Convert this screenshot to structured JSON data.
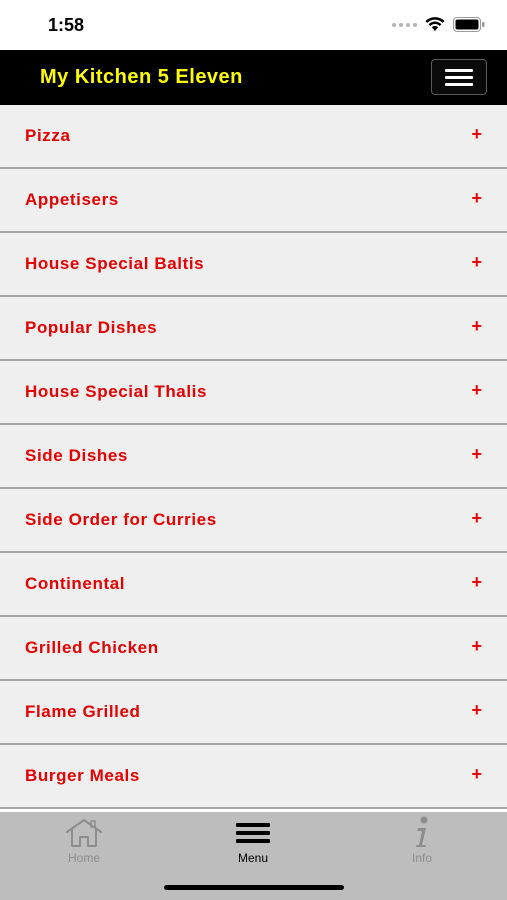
{
  "status": {
    "time": "1:58",
    "icons": [
      "signal-dots-icon",
      "wifi-icon",
      "battery-icon"
    ]
  },
  "header": {
    "title": "My Kitchen 5 Eleven",
    "title_color": "#ffff00",
    "background": "#000000",
    "menu_toggle_icon": "hamburger-icon"
  },
  "menu": {
    "item_color": "#e20000",
    "items": [
      {
        "label": "Pizza",
        "expand": "+"
      },
      {
        "label": "Appetisers",
        "expand": "+"
      },
      {
        "label": "House Special Baltis",
        "expand": "+"
      },
      {
        "label": "Popular Dishes",
        "expand": "+"
      },
      {
        "label": "House Special Thalis",
        "expand": "+"
      },
      {
        "label": "Side Dishes",
        "expand": "+"
      },
      {
        "label": "Side Order for Curries",
        "expand": "+"
      },
      {
        "label": "Continental",
        "expand": "+"
      },
      {
        "label": "Grilled Chicken",
        "expand": "+"
      },
      {
        "label": "Flame Grilled",
        "expand": "+"
      },
      {
        "label": "Burger Meals",
        "expand": "+"
      }
    ]
  },
  "tabs": [
    {
      "label": "Home",
      "icon": "home-icon",
      "active": false
    },
    {
      "label": "Menu",
      "icon": "hamburger-icon",
      "active": true
    },
    {
      "label": "Info",
      "icon": "info-icon",
      "active": false
    }
  ]
}
